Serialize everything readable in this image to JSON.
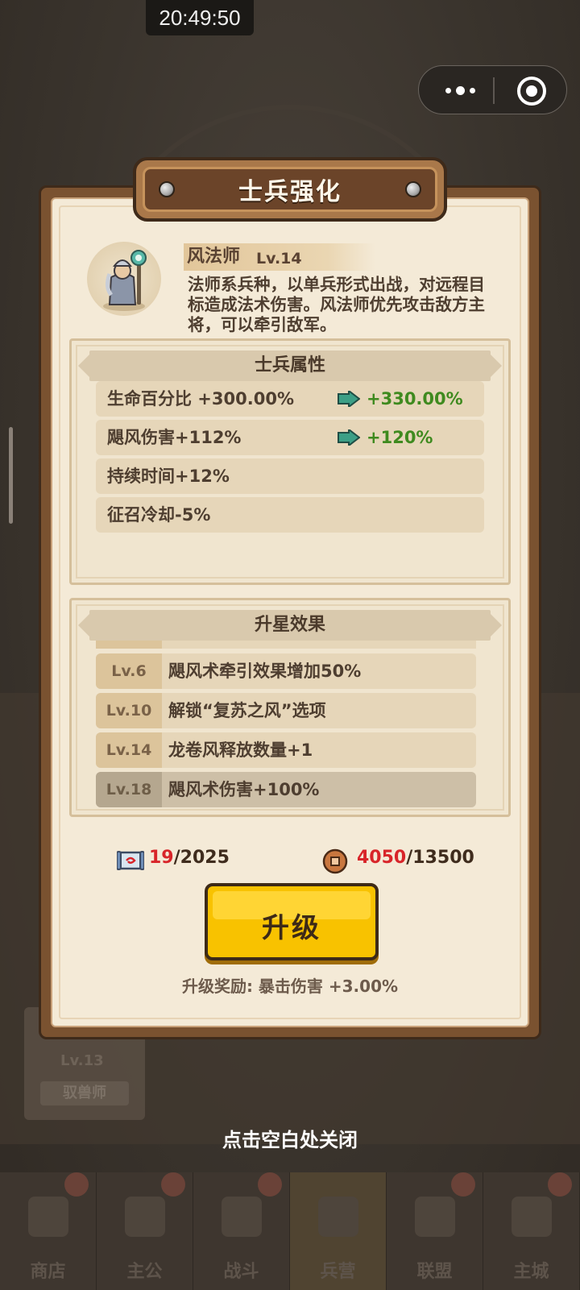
{
  "status_bar": {
    "time": "20:49:50"
  },
  "dialog": {
    "title": "士兵强化",
    "hero": {
      "name": "风法师",
      "level": "Lv.14",
      "description": "法师系兵种，以单兵形式出战，对远程目标造成法术伤害。风法师优先攻击敌方主将，可以牵引敌军。"
    },
    "attributes": {
      "title": "士兵属性",
      "rows": [
        {
          "label": "生命百分比 +300.00%",
          "next": "+330.00%"
        },
        {
          "label": "飓风伤害+112%",
          "next": "+120%"
        },
        {
          "label": "持续时间+12%",
          "next": ""
        },
        {
          "label": "征召冷却-5%",
          "next": ""
        }
      ]
    },
    "star_effects": {
      "title": "升星效果",
      "rows": [
        {
          "level": "Lv.6",
          "effect": "飓风术牵引效果增加50%"
        },
        {
          "level": "Lv.10",
          "effect": "解锁“复苏之风”选项"
        },
        {
          "level": "Lv.14",
          "effect": "龙卷风释放数量+1"
        },
        {
          "level": "Lv.18",
          "effect": "飓风术伤害+100%"
        }
      ]
    },
    "cost": {
      "scroll_have": "19",
      "scroll_need": "/2025",
      "coin_have": "4050",
      "coin_need": "/13500"
    },
    "upgrade_button": "升级",
    "reward": "升级奖励: 暴击伤害 +3.00%"
  },
  "close_hint": "点击空白处关闭",
  "background": {
    "card_level": "Lv.13",
    "card_name": "驭兽师"
  },
  "nav": [
    {
      "label": "商店",
      "icon": "shop-icon"
    },
    {
      "label": "主公",
      "icon": "lord-icon"
    },
    {
      "label": "战斗",
      "icon": "battle-icon"
    },
    {
      "label": "兵营",
      "icon": "barracks-icon"
    },
    {
      "label": "联盟",
      "icon": "alliance-icon"
    },
    {
      "label": "主城",
      "icon": "city-icon"
    }
  ],
  "colors": {
    "accent_green": "#3f8a1f",
    "accent_red": "#d8252a",
    "button_yellow": "#f8c200"
  }
}
